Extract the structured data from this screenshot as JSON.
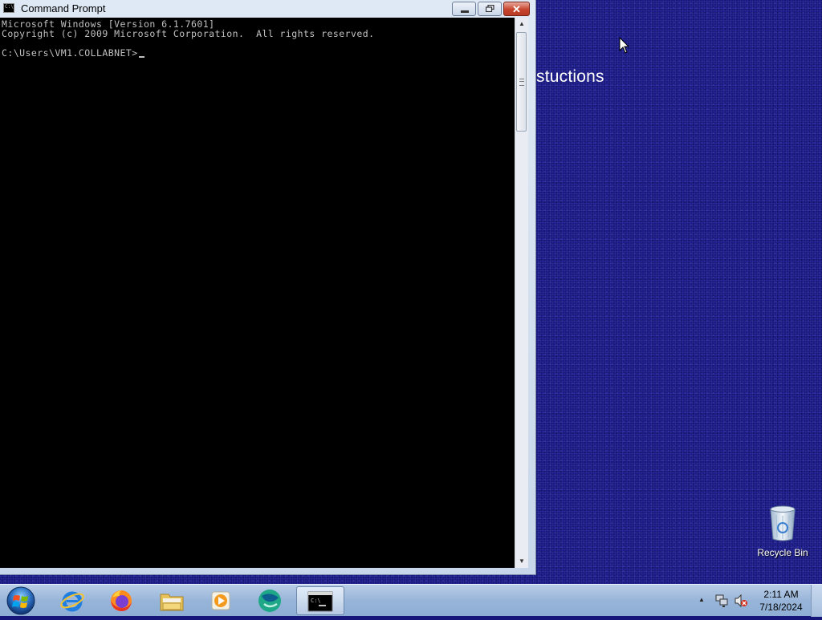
{
  "window": {
    "title": "Command Prompt",
    "buttons": {
      "minimize": "minimize",
      "maximize": "restore",
      "close": "close"
    }
  },
  "console": {
    "lines": [
      "Microsoft Windows [Version 6.1.7601]",
      "Copyright (c) 2009 Microsoft Corporation.  All rights reserved.",
      "C:\\Users\\VM1.COLLABNET>"
    ]
  },
  "desktop": {
    "text": "stuctions",
    "icons": [
      {
        "label": "Recycle Bin",
        "icon": "recycle-bin-icon"
      }
    ]
  },
  "taskbar": {
    "apps": [
      {
        "name": "start-button",
        "icon": "windows-logo-icon"
      },
      {
        "name": "internet-explorer",
        "icon": "internet-explorer-icon"
      },
      {
        "name": "firefox",
        "icon": "firefox-icon"
      },
      {
        "name": "windows-explorer",
        "icon": "folder-icon"
      },
      {
        "name": "media-player",
        "icon": "media-player-icon"
      },
      {
        "name": "browser",
        "icon": "teal-globe-icon"
      },
      {
        "name": "command-prompt",
        "icon": "cmd-icon",
        "active": true
      }
    ],
    "tray": {
      "time": "2:11 AM",
      "date": "7/18/2024"
    }
  },
  "colors": {
    "desktop_bg": "#16167c",
    "console_bg": "#000000",
    "console_fg": "#c0c0c0",
    "taskbar": "#98b5d9"
  }
}
